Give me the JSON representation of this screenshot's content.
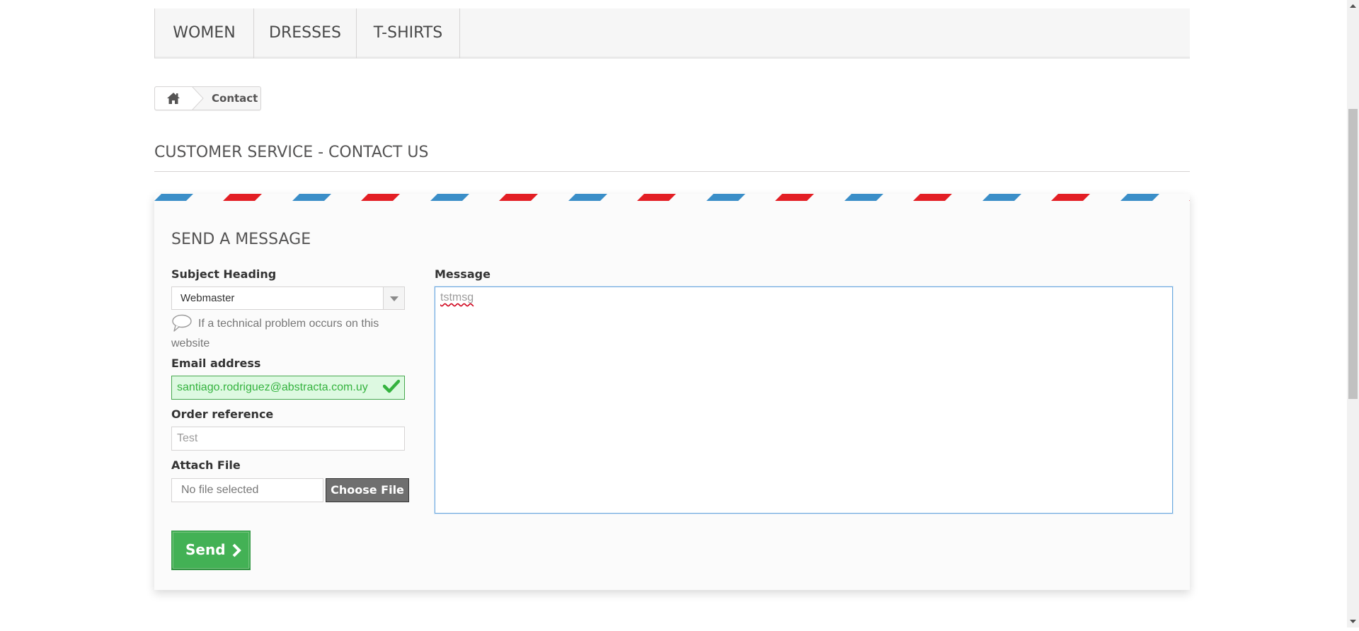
{
  "nav": {
    "items": [
      {
        "label": "WOMEN"
      },
      {
        "label": "DRESSES"
      },
      {
        "label": "T-SHIRTS"
      }
    ]
  },
  "breadcrumb": {
    "home_icon": "home-icon",
    "current": "Contact"
  },
  "page": {
    "heading": "CUSTOMER SERVICE - CONTACT US"
  },
  "form": {
    "heading": "SEND A MESSAGE",
    "stripe_colors": [
      "#3a8ec8",
      "#e31e24"
    ],
    "subject": {
      "label": "Subject Heading",
      "selected": "Webmaster",
      "hint": "If a technical problem occurs on this website"
    },
    "email": {
      "label": "Email address",
      "value": "santiago.rodriguez@abstracta.com.uy",
      "status_icon": "checkmark-icon"
    },
    "order": {
      "label": "Order reference",
      "value": "Test"
    },
    "attach": {
      "label": "Attach File",
      "file_name": "No file selected",
      "button": "Choose File"
    },
    "message": {
      "label": "Message",
      "value": "tstmsg"
    },
    "send_label": "Send"
  },
  "colors": {
    "send_green": "#43b155",
    "valid_green": "#35b33f",
    "focus_blue": "#6ea9df"
  }
}
